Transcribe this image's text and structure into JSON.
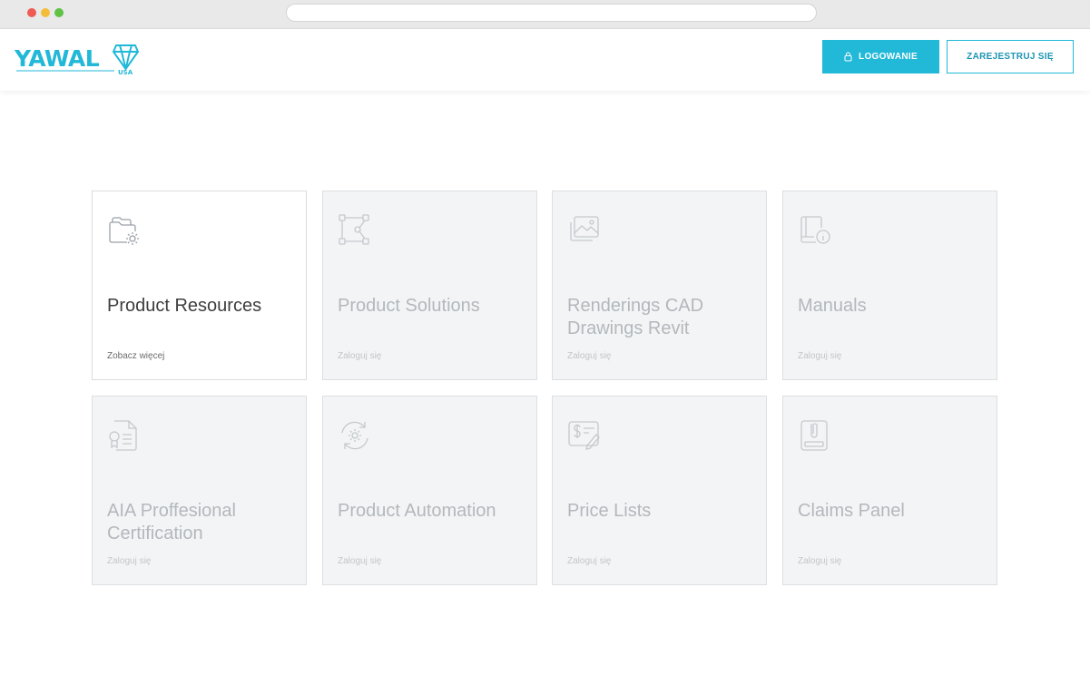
{
  "header": {
    "logo_text": "YAWAL",
    "logo_sub": "USA",
    "login_label": "LOGOWANIE",
    "register_label": "ZAREJESTRUJ SIĘ"
  },
  "colors": {
    "accent": "#22b8d8",
    "card_bg": "#f3f4f5",
    "active_card_bg": "#ffffff"
  },
  "cards": [
    {
      "title": "Product Resources",
      "link": "Zobacz więcej",
      "icon": "folder-gear-icon",
      "active": true
    },
    {
      "title": "Product Solutions",
      "link": "Zaloguj się",
      "icon": "nodes-icon",
      "active": false
    },
    {
      "title": "Renderings CAD Drawings Revit",
      "link": "Zaloguj się",
      "icon": "image-gallery-icon",
      "active": false
    },
    {
      "title": "Manuals",
      "link": "Zaloguj się",
      "icon": "manual-info-icon",
      "active": false
    },
    {
      "title": "AIA Proffesional Certification",
      "link": "Zaloguj się",
      "icon": "certificate-icon",
      "active": false
    },
    {
      "title": "Product Automation",
      "link": "Zaloguj się",
      "icon": "gear-refresh-icon",
      "active": false
    },
    {
      "title": "Price Lists",
      "link": "Zaloguj się",
      "icon": "price-edit-icon",
      "active": false
    },
    {
      "title": "Claims Panel",
      "link": "Zaloguj się",
      "icon": "clipboard-icon",
      "active": false
    }
  ]
}
